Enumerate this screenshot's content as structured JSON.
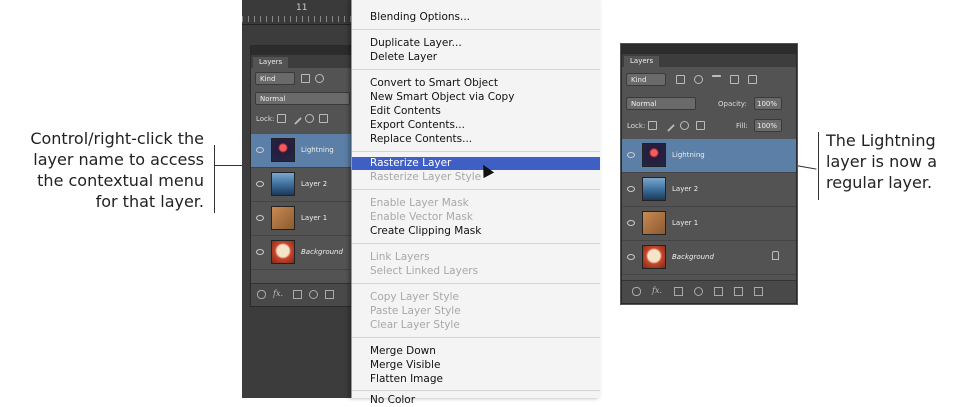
{
  "callouts": {
    "left": [
      "Control/right-click the",
      "layer name to access",
      "the contextual menu",
      "for that layer."
    ],
    "right": [
      "The Lightning",
      "layer is now a",
      "regular layer."
    ]
  },
  "left_panel": {
    "ruler_number": "11",
    "tab": "Layers",
    "filter_kind": "Kind",
    "blend_mode": "Normal",
    "lock_label": "Lock:",
    "layers": [
      "Lightning",
      "Layer 2",
      "Layer 1",
      "Background"
    ],
    "footer_fx": "fx."
  },
  "menu": {
    "items": [
      {
        "label": "Blending Options...",
        "enabled": true
      },
      {
        "sep": true
      },
      {
        "label": "Duplicate Layer...",
        "enabled": true
      },
      {
        "label": "Delete Layer",
        "enabled": true
      },
      {
        "sep": true
      },
      {
        "label": "Convert to Smart Object",
        "enabled": true
      },
      {
        "label": "New Smart Object via Copy",
        "enabled": true
      },
      {
        "label": "Edit Contents",
        "enabled": true
      },
      {
        "label": "Export Contents...",
        "enabled": true
      },
      {
        "label": "Replace Contents...",
        "enabled": true
      },
      {
        "sep": true
      },
      {
        "label": "Rasterize Layer",
        "enabled": true,
        "highlighted": true
      },
      {
        "label": "Rasterize Layer Style",
        "enabled": false
      },
      {
        "sep": true
      },
      {
        "label": "Enable Layer Mask",
        "enabled": false
      },
      {
        "label": "Enable Vector Mask",
        "enabled": false
      },
      {
        "label": "Create Clipping Mask",
        "enabled": true
      },
      {
        "sep": true
      },
      {
        "label": "Link Layers",
        "enabled": false
      },
      {
        "label": "Select Linked Layers",
        "enabled": false
      },
      {
        "sep": true
      },
      {
        "label": "Copy Layer Style",
        "enabled": false
      },
      {
        "label": "Paste Layer Style",
        "enabled": false
      },
      {
        "label": "Clear Layer Style",
        "enabled": false
      },
      {
        "sep": true
      },
      {
        "label": "Merge Down",
        "enabled": true
      },
      {
        "label": "Merge Visible",
        "enabled": true
      },
      {
        "label": "Flatten Image",
        "enabled": true
      },
      {
        "sep": true
      },
      {
        "label": "No Color",
        "enabled": true
      }
    ]
  },
  "right_panel": {
    "tab": "Layers",
    "filter_kind": "Kind",
    "blend_mode": "Normal",
    "opacity_label": "Opacity:",
    "opacity_value": "100%",
    "lock_label": "Lock:",
    "fill_label": "Fill:",
    "fill_value": "100%",
    "layers": [
      "Lightning",
      "Layer 2",
      "Layer 1",
      "Background"
    ],
    "footer_fx": "fx."
  },
  "colors": {
    "menu_highlight": "#3f5fc4",
    "selected_layer": "#5b7fa6",
    "panel_bg": "#535353"
  }
}
